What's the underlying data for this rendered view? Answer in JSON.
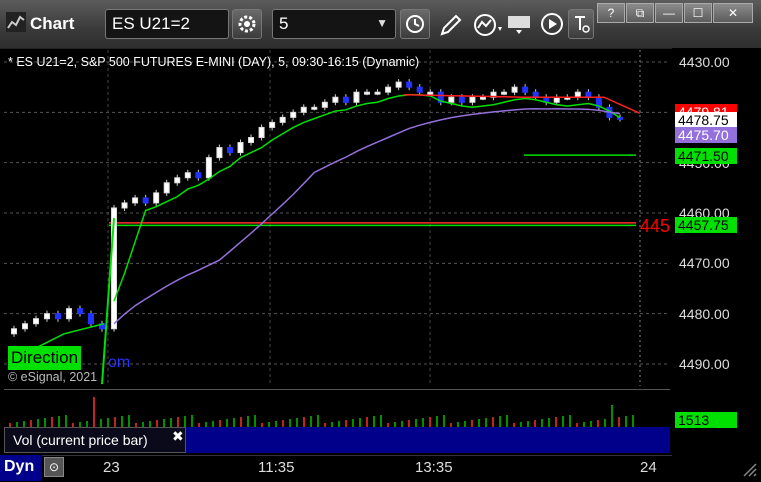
{
  "window": {
    "title": "Chart",
    "symbol": "ES U21=2",
    "interval": "5",
    "window_buttons": [
      "?",
      "⧉",
      "—",
      "☐",
      "✕"
    ]
  },
  "chart": {
    "info": "* ES U21=2, S&P 500 FUTURES E-MINI (DAY), 5, 09:30-16:15 (Dynamic)",
    "direction_label": "Direction",
    "overlay_text": "om",
    "copyright": "© eSignal, 2021",
    "red_price_partial": "445",
    "y_ticks": [
      "4490.00",
      "4480.00",
      "4470.00",
      "4460.00",
      "4450.00",
      "4440.00",
      "4430.00"
    ],
    "price_tags": [
      {
        "label": "4479.81",
        "bg": "#ff0000",
        "fg": "#ffffff"
      },
      {
        "label": "4478.75",
        "bg": "#ffffff",
        "fg": "#000000"
      },
      {
        "label": "4475.70",
        "bg": "#9370db",
        "fg": "#ffffff"
      },
      {
        "label": "4471.50",
        "bg": "#00e000",
        "fg": "#000000"
      },
      {
        "label": "4457.75",
        "bg": "#00e000",
        "fg": "#000000"
      }
    ]
  },
  "volume": {
    "label": "Vol (current price bar)",
    "close": "✖",
    "value": "1513"
  },
  "xaxis": {
    "dyn_label": "Dyn",
    "ticks": [
      "23",
      "11:35",
      "13:35",
      "24"
    ]
  },
  "chart_data": {
    "type": "candlestick",
    "title": "* ES U21=2, S&P 500 FUTURES E-MINI (DAY), 5, 09:30-16:15 (Dynamic)",
    "ylim": [
      4426,
      4492
    ],
    "y_ticks": [
      4430,
      4440,
      4450,
      4460,
      4470,
      4480,
      4490
    ],
    "x_ticks": [
      "23",
      "11:35",
      "13:35",
      "24"
    ],
    "horizontal_lines": [
      {
        "value": 4471.5,
        "color": "#00e000"
      },
      {
        "value": 4457.75,
        "color": "#00e000"
      }
    ],
    "series": [
      {
        "name": "price",
        "close": [
          4437,
          4438,
          4439,
          4440,
          4439,
          4441,
          4440,
          4438,
          4437,
          4461,
          4462,
          4463,
          4462,
          4464,
          4466,
          4467,
          4468,
          4467,
          4471,
          4473,
          4472,
          4474,
          4475,
          4477,
          4478,
          4479,
          4480,
          4481,
          4481,
          4482,
          4483,
          4482,
          4484,
          4484,
          4484,
          4485,
          4486,
          4485,
          4484,
          4484,
          4482,
          4483,
          4482,
          4483,
          4483,
          4484,
          4484,
          4485,
          4484,
          4483,
          4482,
          4483,
          4483,
          4484,
          4483,
          4481,
          4479,
          4478.75
        ]
      }
    ]
  }
}
